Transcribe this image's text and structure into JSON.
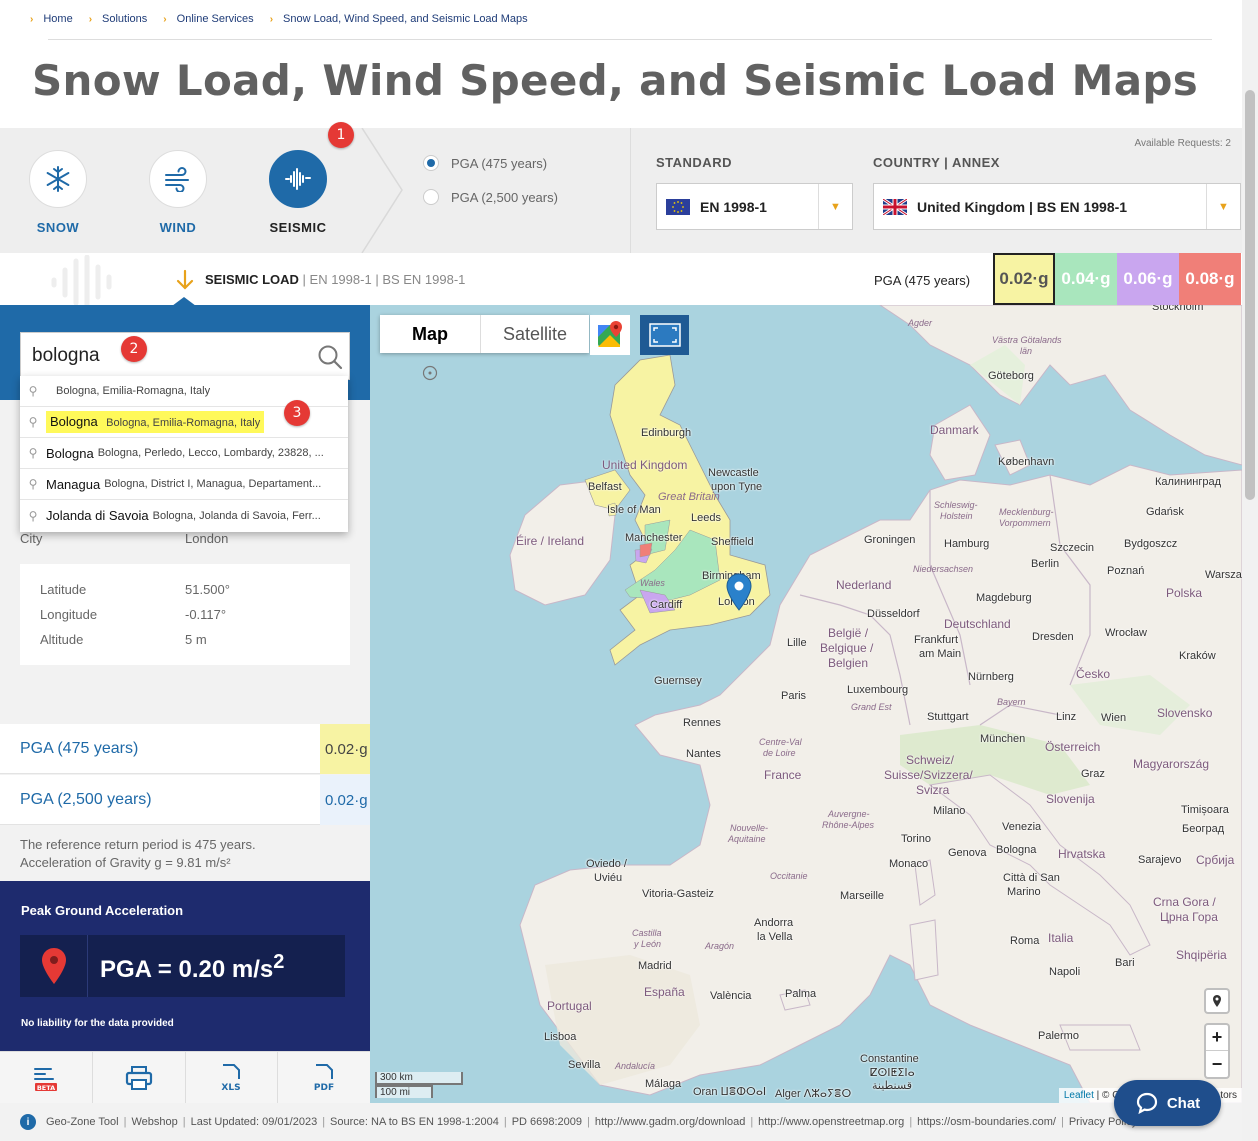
{
  "breadcrumb": [
    "Home",
    "Solutions",
    "Online Services",
    "Snow Load, Wind Speed, and Seismic Load Maps"
  ],
  "page_title": "Snow Load, Wind Speed, and Seismic Load Maps",
  "load_types": [
    {
      "label": "SNOW",
      "icon": "snowflake-icon",
      "active": false
    },
    {
      "label": "WIND",
      "icon": "wind-icon",
      "active": false
    },
    {
      "label": "SEISMIC",
      "icon": "seismic-icon",
      "active": true
    }
  ],
  "badges": [
    "1",
    "2",
    "3"
  ],
  "return_period_options": [
    {
      "label": "PGA (475 years)",
      "selected": true
    },
    {
      "label": "PGA (2,500 years)",
      "selected": false
    }
  ],
  "standard": {
    "label": "STANDARD",
    "value": "EN 1998-1"
  },
  "country_annex": {
    "label": "COUNTRY | ANNEX",
    "value": "United Kingdom | BS EN 1998-1"
  },
  "available_requests": "Available Requests: 2",
  "status": {
    "title": "SEISMIC LOAD",
    "standard": "EN 1998-1",
    "annex": "BS EN 1998-1"
  },
  "legend": {
    "label": "PGA (475 years)",
    "items": [
      {
        "value": "0.02·g",
        "color": "#f7f3a3"
      },
      {
        "value": "0.04·g",
        "color": "#a9e6bd"
      },
      {
        "value": "0.06·g",
        "color": "#c9a6ef"
      },
      {
        "value": "0.08·g",
        "color": "#f07f78"
      }
    ]
  },
  "search": {
    "value": "bologna"
  },
  "suggestions": [
    {
      "main": "",
      "sub": "Bologna, Emilia-Romagna, Italy"
    },
    {
      "main": "Bologna",
      "sub": "Bologna, Emilia-Romagna, Italy"
    },
    {
      "main": "Bologna",
      "sub": "Bologna, Perledo, Lecco, Lombardy, 23828, ..."
    },
    {
      "main": "Managua",
      "sub": "Bologna, District I, Managua, Departament..."
    },
    {
      "main": "Jolanda di Savoia",
      "sub": "Bologna, Jolanda di Savoia, Ferr..."
    }
  ],
  "location": {
    "city_label": "City",
    "city_value": "London",
    "lat_label": "Latitude",
    "lat_value": "51.500°",
    "lon_label": "Longitude",
    "lon_value": "-0.117°",
    "alt_label": "Altitude",
    "alt_value": "5 m"
  },
  "results": [
    {
      "label": "PGA (475 years)",
      "value": "0.02·g"
    },
    {
      "label": "PGA (2,500 years)",
      "value": "0.02·g"
    }
  ],
  "notes": [
    "The reference return period is 475 years.",
    "Acceleration of Gravity g = 9.81 m/s²"
  ],
  "pga_box": {
    "title": "Peak Ground Acceleration",
    "value": "PGA = 0.20 m/s",
    "exponent": "2",
    "liability": "No liability for the data provided"
  },
  "toolbar": [
    {
      "icon": "geo-zone-beta-icon",
      "label": "BETA"
    },
    {
      "icon": "print-icon",
      "label": ""
    },
    {
      "icon": "xls-icon",
      "label": "XLS"
    },
    {
      "icon": "pdf-icon",
      "label": "PDF"
    }
  ],
  "map": {
    "tab_map": "Map",
    "tab_satellite": "Satellite",
    "scale_km": "300 km",
    "scale_mi": "100 mi",
    "attribution_link": "Leaflet",
    "attribution_text": "| © Op",
    "attribution_tail": "tors",
    "labels": {
      "agder": "Agder",
      "vastra": "Västra Götalands",
      "vastra2": "län",
      "goteborg": "Göteborg",
      "stockholm": "Stockholm",
      "denmark": "Danmark",
      "kobenhavn": "København",
      "kaliningrad": "Калининград",
      "gdansk": "Gdańsk",
      "edinburgh": "Edinburgh",
      "uk": "United Kingdom",
      "newcastle": "Newcastle",
      "newcastle2": "upon Tyne",
      "belfast": "Belfast",
      "isleman": "Isle of Man",
      "greatbritain": "Great Britain",
      "leeds": "Leeds",
      "eire": "Éire / Ireland",
      "manchester": "Manchester",
      "sheffield": "Sheffield",
      "wales": "Wales",
      "birmingham": "Birmingham",
      "cardiff": "Cardiff",
      "london": "London",
      "schleswig": "Schleswig-",
      "holstein": "Holstein",
      "mecklenburg": "Mecklenburg-",
      "vorpommern": "Vorpommern",
      "groningen": "Groningen",
      "hamburg": "Hamburg",
      "szczecin": "Szczecin",
      "bydgoszcz": "Bydgoszcz",
      "niedersachsen": "Niedersachsen",
      "berlin": "Berlin",
      "poznan": "Poznań",
      "warszawa": "Warszaw",
      "nederland": "Nederland",
      "polska": "Polska",
      "magdeburg": "Magdeburg",
      "dusseldorf": "Düsseldorf",
      "deutschland": "Deutschland",
      "lille": "Lille",
      "belgie": "België /",
      "belgique": "Belgique /",
      "belgien": "Belgien",
      "frankfurt": "Frankfurt",
      "frankfurt2": "am Main",
      "dresden": "Dresden",
      "wroclaw": "Wrocław",
      "krakow": "Kraków",
      "guernsey": "Guernsey",
      "luxembourg": "Luxembourg",
      "cesko": "Česko",
      "paris": "Paris",
      "grandest": "Grand Est",
      "nurnberg": "Nürnberg",
      "bayern": "Bayern",
      "rennes": "Rennes",
      "stuttgart": "Stuttgart",
      "linz": "Linz",
      "wien": "Wien",
      "slovensko": "Slovensko",
      "centreval": "Centre-Val",
      "deloire": "de Loire",
      "nantes": "Nantes",
      "munchen": "München",
      "osterreich": "Österreich",
      "france": "France",
      "schweiz": "Schweiz/",
      "suisse": "Suisse/Svizzera/",
      "svizra": "Svizra",
      "graz": "Graz",
      "magyar": "Magyarország",
      "slovenija": "Slovenija",
      "auvergne": "Auvergne-",
      "rhonealpes": "Rhône-Alpes",
      "milano": "Milano",
      "timisoara": "Timișoara",
      "nouvelle": "Nouvelle-",
      "aquitaine": "Aquitaine",
      "torino": "Torino",
      "venezia": "Venezia",
      "beograd": "Београд",
      "genova": "Genova",
      "bologna": "Bologna",
      "hrvatska": "Hrvatska",
      "monaco": "Monaco",
      "sarajevo": "Sarajevo",
      "srbija": "Србија",
      "oviedo": "Oviedo /",
      "uvieu": "Uviéu",
      "occitanie": "Occitanie",
      "cittadisan": "Città di San",
      "marino": "Marino",
      "vitoria": "Vitoria-Gasteiz",
      "marseille": "Marseille",
      "crnagora": "Crna Gora /",
      "crnagora2": "Црна Гора",
      "andorra": "Andorra",
      "andorra2": "la Vella",
      "castilla": "Castilla",
      "castilla2": "y León",
      "aragon": "Aragón",
      "roma": "Roma",
      "italia": "Italia",
      "shqiperia": "Shqipëria",
      "madrid": "Madrid",
      "espana": "España",
      "napoli": "Napoli",
      "bari": "Bari",
      "valencia": "València",
      "palma": "Palma",
      "portugal": "Portugal",
      "lisboa": "Lisboa",
      "palermo": "Palermo",
      "sevilla": "Sevilla",
      "andalucia": "Andalucía",
      "malaga": "Málaga",
      "constantine": "Constantine",
      "constantine2": "ⵇⵙⵏⵟⵉⵏⴰ",
      "constantine3": "قسنطينة",
      "oran": "Oran ⵡⴻⵀⵔⴰⵏ",
      "alger": "Alger ⴷⵣⴰⵢⴻⵔ"
    }
  },
  "chat": {
    "label": "Chat"
  },
  "footer": [
    "Geo-Zone Tool",
    "Webshop",
    "Last Updated: 09/01/2023",
    "Source: NA to BS EN 1998-1:2004",
    "PD 6698:2009",
    "http://www.gadm.org/download",
    "http://www.openstreetmap.org",
    "https://osm-boundaries.com/",
    "Privacy Policy"
  ]
}
